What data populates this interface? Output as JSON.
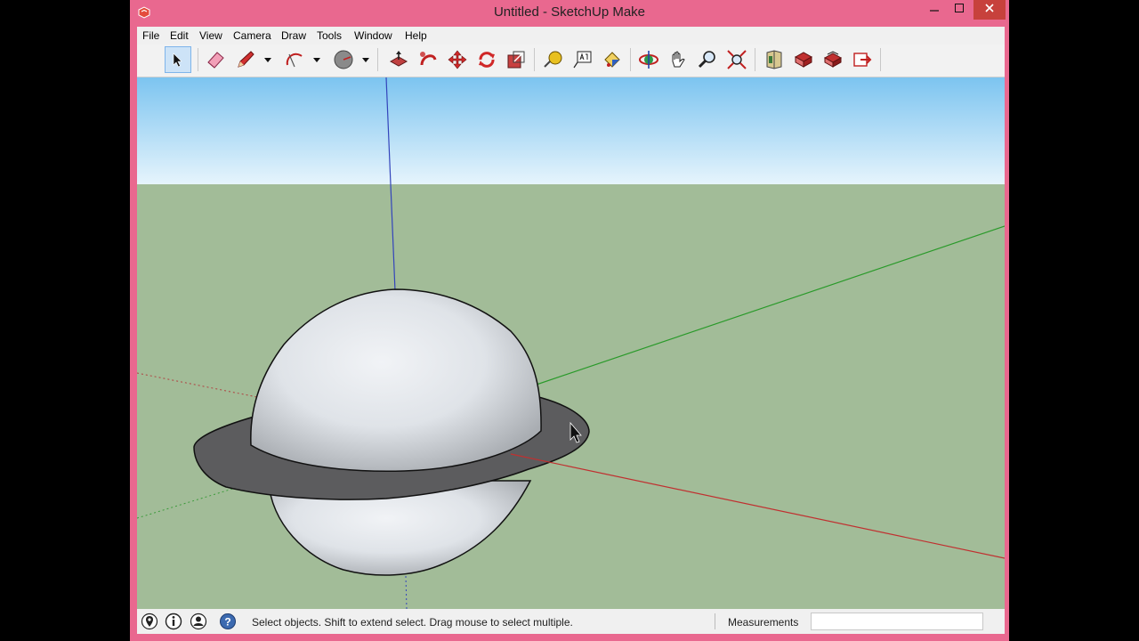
{
  "window": {
    "title": "Untitled - SketchUp Make"
  },
  "menu": [
    "File",
    "Edit",
    "View",
    "Camera",
    "Draw",
    "Tools",
    "Window",
    "Help"
  ],
  "status": {
    "message": "Select objects. Shift to extend select. Drag mouse to select multiple.",
    "measurements_label": "Measurements",
    "measurements_value": ""
  },
  "colors": {
    "title_bar": "#e9688f",
    "sky_top": "#7cc4f0",
    "ground": "#a2bc98",
    "sphere": "#e4e8ec",
    "ring": "#5c5c5e",
    "axis_red": "#c03030",
    "axis_green": "#2a9a2a",
    "axis_blue": "#3344bb"
  },
  "toolbar_icons": [
    "select-icon",
    "eraser-icon",
    "pencil-icon",
    "arc-icon",
    "circle-icon",
    "push-pull-icon",
    "follow-me-icon",
    "move-icon",
    "rotate-icon",
    "scale-icon",
    "tape-measure-icon",
    "text-icon",
    "paint-bucket-icon",
    "orbit-icon",
    "pan-icon",
    "zoom-icon",
    "zoom-extents-icon",
    "3d-warehouse-icon",
    "share-model-icon",
    "extension-warehouse-icon",
    "send-to-layout-icon"
  ]
}
